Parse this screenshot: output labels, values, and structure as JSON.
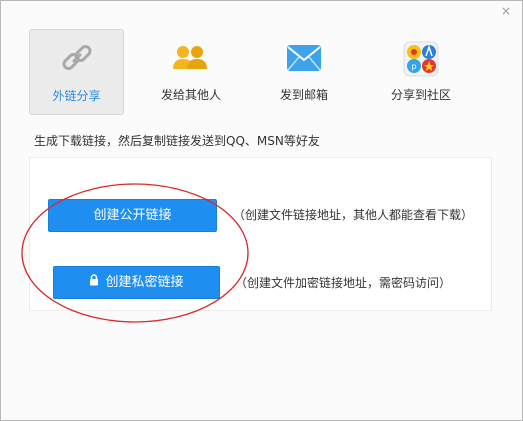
{
  "dialog": {
    "close_glyph": "×"
  },
  "tabs": [
    {
      "label": "外链分享",
      "icon": "link-icon",
      "active": true
    },
    {
      "label": "发给其他人",
      "icon": "users-icon",
      "active": false
    },
    {
      "label": "发到邮箱",
      "icon": "mail-icon",
      "active": false
    },
    {
      "label": "分享到社区",
      "icon": "community-icon",
      "active": false
    }
  ],
  "description": "生成下载链接，然后复制链接发送到QQ、MSN等好友",
  "actions": {
    "public": {
      "label": "创建公开链接",
      "note": "（创建文件链接地址，其他人都能查看下载）"
    },
    "private": {
      "label": "创建私密链接",
      "note": "（创建文件加密链接地址，需密码访问）",
      "icon": "lock-icon"
    }
  },
  "colors": {
    "accent": "#1e8ff0",
    "active_tab_text": "#2b8ae0",
    "annotation": "#d9292b"
  }
}
